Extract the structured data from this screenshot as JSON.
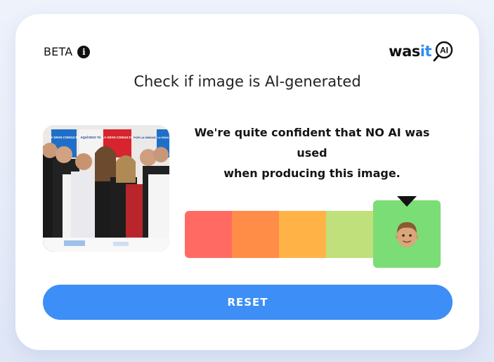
{
  "header": {
    "beta_label": "BETA",
    "logo": {
      "prefix": "was",
      "accent": "it",
      "badge": "AI"
    }
  },
  "title": "Check if image is AI-generated",
  "verdict": {
    "line1": "We're quite confident that NO AI was used",
    "line2": "when producing this image."
  },
  "scale": {
    "colors": [
      "#ff6b63",
      "#ff8c47",
      "#ffb347",
      "#bfe07a"
    ],
    "active_color": "#7bdd75",
    "selected_index": 4,
    "icon": "person-emoji-icon"
  },
  "photo": {
    "banners": [
      "LA GRAN CONSULTA",
      "AQUÍ DIGO TÚ",
      "LA GRAN CONSULTA",
      "POR LA UNIDAD",
      "LA GRAN"
    ]
  },
  "reset_label": "RESET",
  "colors": {
    "accent": "#3d8ef6",
    "logo_accent": "#2f8df5"
  }
}
